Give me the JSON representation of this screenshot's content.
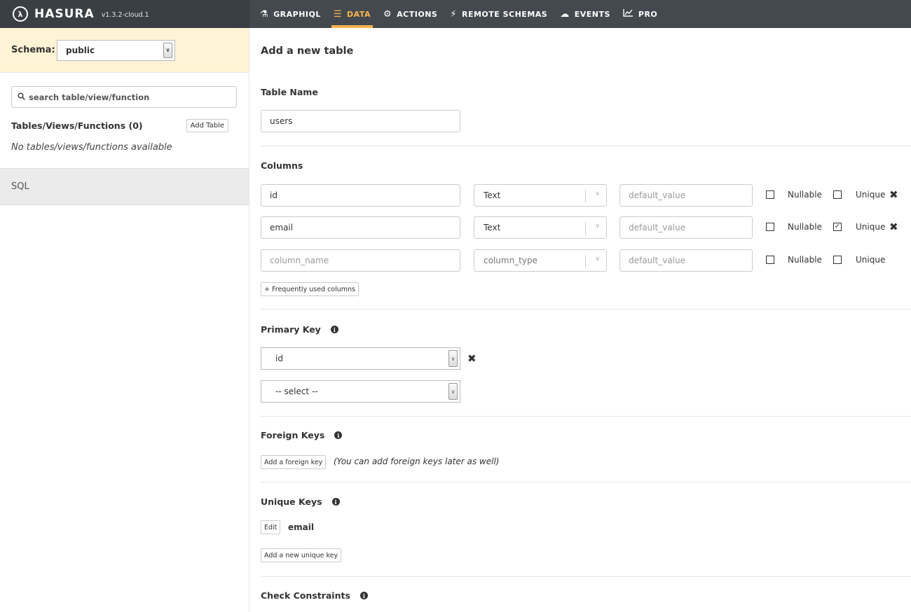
{
  "nav": {
    "brand": "HASURA",
    "version": "v1.3.2-cloud.1",
    "items": [
      {
        "label": "GRAPHIQL",
        "icon": "flask-icon"
      },
      {
        "label": "DATA",
        "icon": "database-icon"
      },
      {
        "label": "ACTIONS",
        "icon": "cogs-icon"
      },
      {
        "label": "REMOTE SCHEMAS",
        "icon": "plug-icon"
      },
      {
        "label": "EVENTS",
        "icon": "cloud-icon"
      },
      {
        "label": "PRO",
        "icon": "line-chart-icon"
      }
    ],
    "active": "DATA",
    "accent_color": "#feb54f"
  },
  "sidebar": {
    "schema_label": "Schema:",
    "schema_value": "public",
    "search_placeholder": "search table/view/function",
    "tables_title": "Tables/Views/Functions (0)",
    "add_table_label": "Add Table",
    "empty_text": "No tables/views/functions available",
    "sql_label": "SQL"
  },
  "main": {
    "title": "Add a new table",
    "table_name": {
      "label": "Table Name",
      "value": "users"
    },
    "columns": {
      "label": "Columns",
      "nullable_label": "Nullable",
      "unique_label": "Unique",
      "rows": [
        {
          "name": "id",
          "type": "Text",
          "default_placeholder": "default_value",
          "nullable": false,
          "unique": false,
          "removable": true
        },
        {
          "name": "email",
          "type": "Text",
          "default_placeholder": "default_value",
          "nullable": false,
          "unique": true,
          "removable": true
        },
        {
          "name": "",
          "name_placeholder": "column_name",
          "type": "",
          "type_placeholder": "column_type",
          "default_placeholder": "default_value",
          "nullable": false,
          "unique": false,
          "removable": false
        }
      ],
      "frequent_button": "+ Frequently used columns"
    },
    "primary_key": {
      "label": "Primary Key",
      "selected": "id",
      "empty_option": "-- select --"
    },
    "foreign_keys": {
      "label": "Foreign Keys",
      "add_button": "Add a foreign key",
      "note": "(You can add foreign keys later as well)"
    },
    "unique_keys": {
      "label": "Unique Keys",
      "edit_button": "Edit",
      "key_value": "email",
      "add_button": "Add a new unique key"
    },
    "check_constraints": {
      "label": "Check Constraints"
    }
  }
}
